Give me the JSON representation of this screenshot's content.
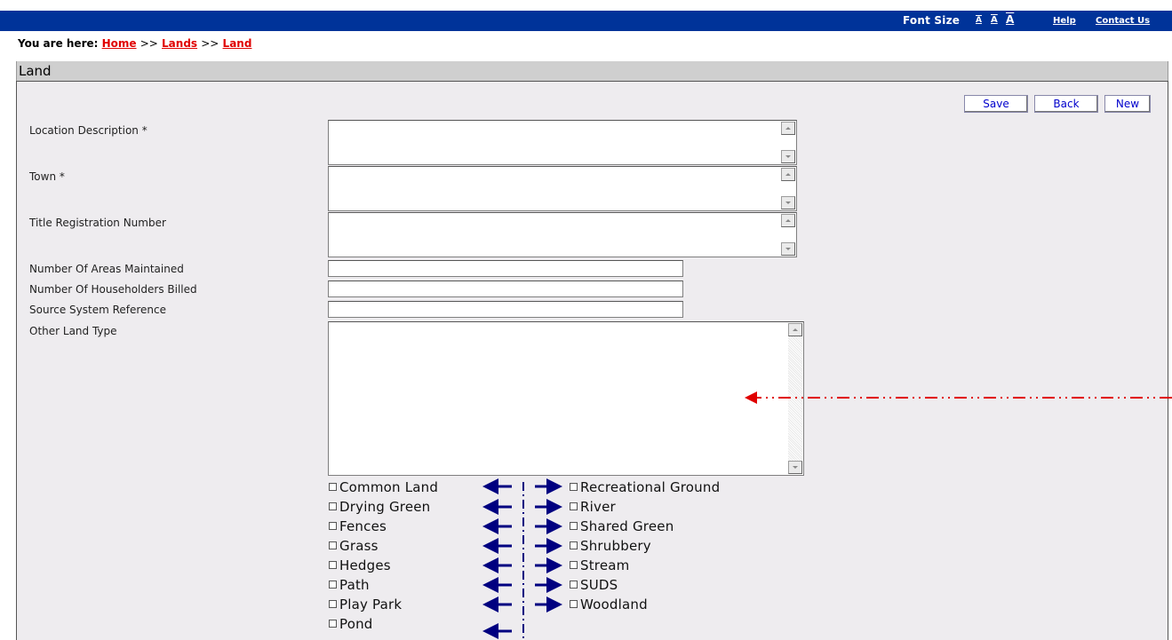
{
  "header": {
    "font_size_label": "Font Size",
    "font_size_options": [
      "A",
      "A",
      "A"
    ],
    "help": "Help",
    "contact": "Contact Us"
  },
  "breadcrumb": {
    "prefix": "You are here:",
    "items": [
      "Home",
      "Lands",
      "Land"
    ],
    "separator": ">>"
  },
  "panel": {
    "title": "Land"
  },
  "actions": {
    "save": "Save",
    "back": "Back",
    "new": "New"
  },
  "fields": {
    "location_description": {
      "label": "Location Description *",
      "value": ""
    },
    "town": {
      "label": "Town *",
      "value": ""
    },
    "title_registration_number": {
      "label": "Title Registration Number",
      "value": ""
    },
    "number_of_areas_maintained": {
      "label": "Number Of Areas Maintained",
      "value": ""
    },
    "number_of_householders_billed": {
      "label": "Number Of Householders Billed",
      "value": ""
    },
    "source_system_reference": {
      "label": "Source System Reference",
      "value": ""
    },
    "other_land_type": {
      "label": "Other Land Type",
      "value": ""
    }
  },
  "land_types_left": [
    {
      "label": "Common Land",
      "checked": false
    },
    {
      "label": "Drying Green",
      "checked": false
    },
    {
      "label": "Fences",
      "checked": false
    },
    {
      "label": "Grass",
      "checked": false
    },
    {
      "label": "Hedges",
      "checked": false
    },
    {
      "label": "Path",
      "checked": false
    },
    {
      "label": "Play Park",
      "checked": false
    },
    {
      "label": "Pond",
      "checked": false
    }
  ],
  "land_types_right": [
    {
      "label": "Recreational Ground",
      "checked": false
    },
    {
      "label": "River",
      "checked": false
    },
    {
      "label": "Shared Green",
      "checked": false
    },
    {
      "label": "Shrubbery",
      "checked": false
    },
    {
      "label": "Stream",
      "checked": false
    },
    {
      "label": "SUDS",
      "checked": false
    },
    {
      "label": "Woodland",
      "checked": false
    }
  ],
  "colors": {
    "header_bg": "#003399",
    "link_red": "#e00000",
    "panel_bg": "#eeecef",
    "button_text": "#0000cc",
    "annotation_red": "#e00000",
    "annotation_blue": "#000080"
  }
}
